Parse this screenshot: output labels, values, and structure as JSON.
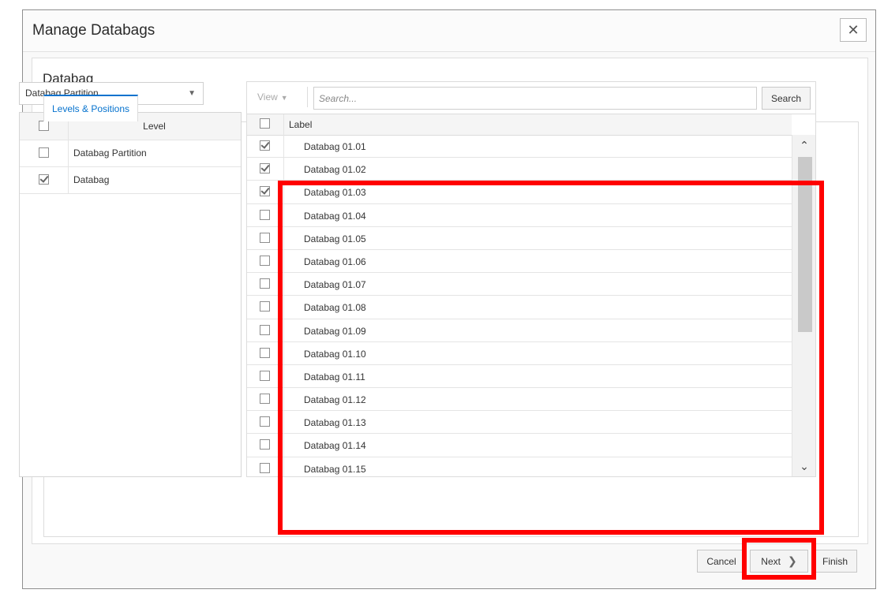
{
  "dialog": {
    "title": "Manage Databags",
    "close_glyph": "✕"
  },
  "section": {
    "title": "Databag"
  },
  "tabs": [
    {
      "label": "Levels & Positions",
      "active": true
    }
  ],
  "level_select": {
    "value": "Databag Partition",
    "caret": "▼"
  },
  "level_table": {
    "header": "Level",
    "rows": [
      {
        "label": "Databag Partition",
        "checked": false
      },
      {
        "label": "Databag",
        "checked": true
      }
    ]
  },
  "toolbar": {
    "view_label": "View",
    "view_caret": "▼",
    "search_placeholder": "Search...",
    "search_button": "Search"
  },
  "label_table": {
    "header": "Label",
    "rows": [
      {
        "label": "Databag 01.01",
        "checked": true
      },
      {
        "label": "Databag 01.02",
        "checked": true
      },
      {
        "label": "Databag 01.03",
        "checked": true
      },
      {
        "label": "Databag 01.04",
        "checked": false
      },
      {
        "label": "Databag 01.05",
        "checked": false
      },
      {
        "label": "Databag 01.06",
        "checked": false
      },
      {
        "label": "Databag 01.07",
        "checked": false
      },
      {
        "label": "Databag 01.08",
        "checked": false
      },
      {
        "label": "Databag 01.09",
        "checked": false
      },
      {
        "label": "Databag 01.10",
        "checked": false
      },
      {
        "label": "Databag 01.11",
        "checked": false
      },
      {
        "label": "Databag 01.12",
        "checked": false
      },
      {
        "label": "Databag 01.13",
        "checked": false
      },
      {
        "label": "Databag 01.14",
        "checked": false
      },
      {
        "label": "Databag 01.15",
        "checked": false
      }
    ],
    "scroll_up_glyph": "⌃",
    "scroll_down_glyph": "⌄"
  },
  "footer": {
    "cancel": "Cancel",
    "next": "Next",
    "next_chevron": "❯",
    "finish": "Finish"
  },
  "colors": {
    "accent": "#0572ce",
    "highlight": "#ff0000"
  }
}
